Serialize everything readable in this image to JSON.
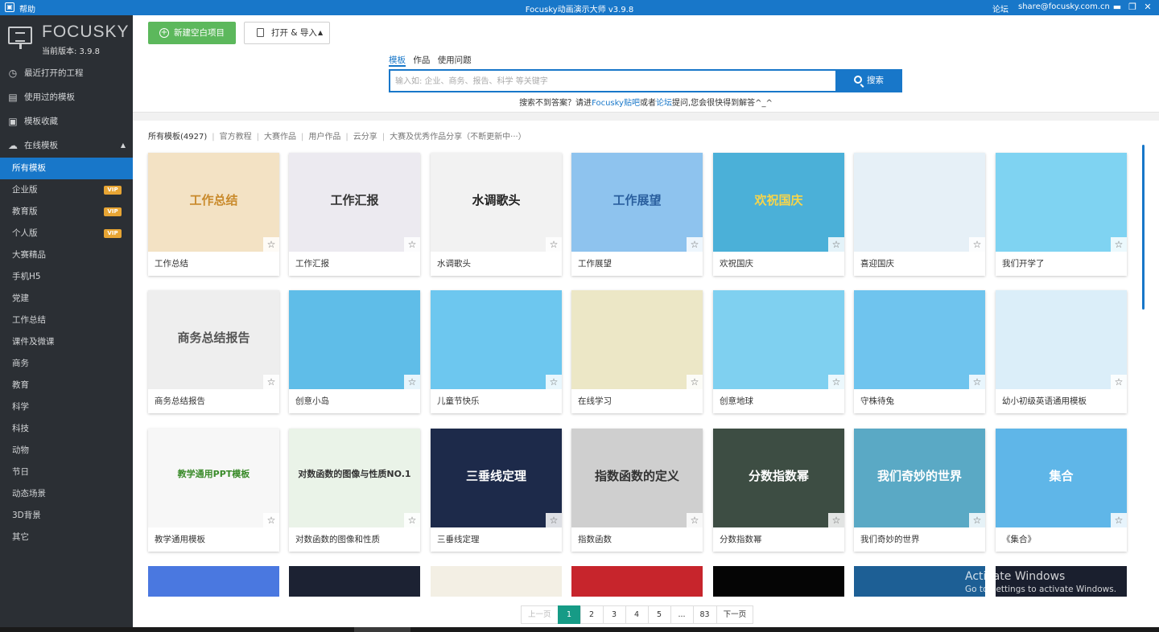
{
  "titlebar": {
    "help": "帮助",
    "title": "Focusky动画演示大师 v3.9.8",
    "forum": "论坛",
    "email": "share@focusky.com.cn",
    "minimize": "▬",
    "restore": "❐",
    "close": "✕"
  },
  "brand": {
    "logo": "FOCUSKY",
    "version": "当前版本: 3.9.8"
  },
  "sidebar": {
    "items": [
      {
        "label": "最近打开的工程",
        "icon": "clock-icon"
      },
      {
        "label": "使用过的模板",
        "icon": "template-icon"
      },
      {
        "label": "模板收藏",
        "icon": "favorite-icon"
      },
      {
        "label": "在线模板",
        "icon": "cloud-icon"
      }
    ],
    "sub_items": [
      {
        "label": "所有模板",
        "vip": ""
      },
      {
        "label": "企业版",
        "vip": "VIP"
      },
      {
        "label": "教育版",
        "vip": "VIP"
      },
      {
        "label": "个人版",
        "vip": "VIP"
      },
      {
        "label": "大赛精品",
        "vip": ""
      },
      {
        "label": "手机H5",
        "vip": ""
      },
      {
        "label": "党建",
        "vip": ""
      },
      {
        "label": "工作总结",
        "vip": ""
      },
      {
        "label": "课件及微课",
        "vip": ""
      },
      {
        "label": "商务",
        "vip": ""
      },
      {
        "label": "教育",
        "vip": ""
      },
      {
        "label": "科学",
        "vip": ""
      },
      {
        "label": "科技",
        "vip": ""
      },
      {
        "label": "动物",
        "vip": ""
      },
      {
        "label": "节日",
        "vip": ""
      },
      {
        "label": "动态场景",
        "vip": ""
      },
      {
        "label": "3D背景",
        "vip": ""
      },
      {
        "label": "其它",
        "vip": ""
      }
    ]
  },
  "toolbar": {
    "new_project": "新建空白项目",
    "open_import": "打开 & 导入"
  },
  "search": {
    "tabs": [
      "模板",
      "作品",
      "使用问题"
    ],
    "placeholder": "输入如: 企业、商务、报告、科学 等关键字",
    "button": "搜索",
    "hint_1": "搜索不到答案？请进",
    "hint_link_1": "Focusky贴吧",
    "hint_2": "或者",
    "hint_link_2": "论坛",
    "hint_3": "提问,您会很快得到解答^_^"
  },
  "categories": [
    "所有模板(4927)",
    "官方教程",
    "大赛作品",
    "用户作品",
    "云分享",
    "大赛及优秀作品分享（不断更新中···）"
  ],
  "templates": [
    {
      "label": "工作总结",
      "thumb_text": "工作总结",
      "bg": "#f3e2c4",
      "fg": "#c98a2b"
    },
    {
      "label": "工作汇报",
      "thumb_text": "工作汇报",
      "bg": "#eceaf0",
      "fg": "#333333"
    },
    {
      "label": "水调歌头",
      "thumb_text": "水调歌头",
      "bg": "#f2f2f2",
      "fg": "#222222"
    },
    {
      "label": "工作展望",
      "thumb_text": "工作展望",
      "bg": "#8ec3ee",
      "fg": "#2a5f9e"
    },
    {
      "label": "欢祝国庆",
      "thumb_text": "欢祝国庆",
      "bg": "#4bb0d8",
      "fg": "#f7d54a"
    },
    {
      "label": "喜迎国庆",
      "thumb_text": "",
      "bg": "#e6f0f7",
      "fg": "#c0392b"
    },
    {
      "label": "我们开学了",
      "thumb_text": "",
      "bg": "#7fd3f2",
      "fg": "#3a7d2c"
    },
    {
      "label": "商务总结报告",
      "thumb_text": "商务总结报告",
      "bg": "#eeeeee",
      "fg": "#555555"
    },
    {
      "label": "创意小岛",
      "thumb_text": "",
      "bg": "#5fbde8",
      "fg": "#6a8f2a"
    },
    {
      "label": "儿童节快乐",
      "thumb_text": "",
      "bg": "#6dc7ef",
      "fg": "#3a8b2a"
    },
    {
      "label": "在线学习",
      "thumb_text": "",
      "bg": "#ece7c6",
      "fg": "#2a6db0"
    },
    {
      "label": "创意地球",
      "thumb_text": "",
      "bg": "#7fd0f0",
      "fg": "#3a8b2a"
    },
    {
      "label": "守株待兔",
      "thumb_text": "",
      "bg": "#6fc4ee",
      "fg": "#2c8f48"
    },
    {
      "label": "幼小初级英语通用模板",
      "thumb_text": "",
      "bg": "#dbeef9",
      "fg": "#3a7d2c"
    },
    {
      "label": "教学通用模板",
      "thumb_text": "教学通用PPT模板",
      "bg": "#f7f7f7",
      "fg": "#3a8b2a"
    },
    {
      "label": "对数函数的图像和性质",
      "thumb_text": "对数函数的图像与性质NO.1",
      "bg": "#eaf3e8",
      "fg": "#333333"
    },
    {
      "label": "三垂线定理",
      "thumb_text": "三垂线定理",
      "bg": "#1d2a4a",
      "fg": "#ffffff"
    },
    {
      "label": "指数函数",
      "thumb_text": "指数函数的定义",
      "bg": "#cfcfcf",
      "fg": "#333333"
    },
    {
      "label": "分数指数幂",
      "thumb_text": "分数指数幂",
      "bg": "#3d4d43",
      "fg": "#ffffff"
    },
    {
      "label": "我们奇妙的世界",
      "thumb_text": "我们奇妙的世界",
      "bg": "#5aa9c5",
      "fg": "#ffffff"
    },
    {
      "label": "《集合》",
      "thumb_text": "集合",
      "bg": "#5fb6e8",
      "fg": "#ffffff"
    }
  ],
  "partial_thumbs": [
    {
      "bg": "#4a78e0"
    },
    {
      "bg": "#1c2233"
    },
    {
      "bg": "#f3efe4"
    },
    {
      "bg": "#c7252c"
    },
    {
      "bg": "#050505"
    },
    {
      "bg": "#1d5f95"
    },
    {
      "bg": "#1a1f2e"
    }
  ],
  "pagination": [
    "上一页",
    "1",
    "2",
    "3",
    "4",
    "5",
    "...",
    "83",
    "下一页"
  ],
  "watermark": {
    "line1": "Activate Windows",
    "line2": "Go to Settings to activate Windows."
  }
}
